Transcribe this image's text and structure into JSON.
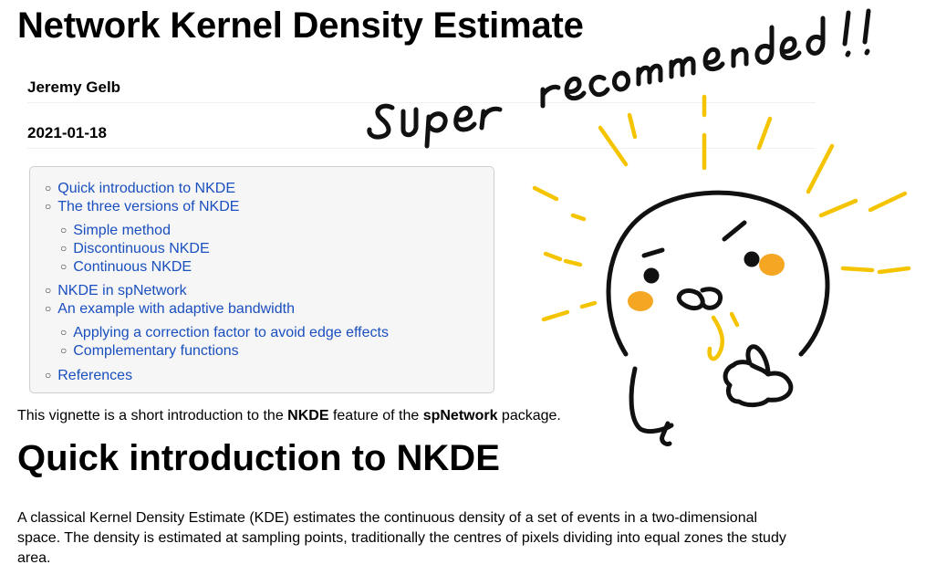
{
  "document": {
    "title": "Network Kernel Density Estimate",
    "author": "Jeremy Gelb",
    "date": "2021-01-18"
  },
  "toc": {
    "items": [
      {
        "label": "Quick introduction to NKDE",
        "level": 1
      },
      {
        "label": "The three versions of NKDE",
        "level": 1
      },
      {
        "label": "Simple method",
        "level": 2
      },
      {
        "label": "Discontinuous NKDE",
        "level": 2
      },
      {
        "label": "Continuous NKDE",
        "level": 2
      },
      {
        "label": "NKDE in spNetwork",
        "level": 1
      },
      {
        "label": "An example with adaptive bandwidth",
        "level": 1
      },
      {
        "label": "Applying a correction factor to avoid edge effects",
        "level": 2
      },
      {
        "label": "Complementary functions",
        "level": 2
      },
      {
        "label": "References",
        "level": 1
      }
    ]
  },
  "intro": {
    "part1": "This vignette is a short introduction to the ",
    "bold1": "NKDE",
    "part2": " feature of the ",
    "bold2": "spNetwork",
    "part3": " package."
  },
  "section": {
    "title": "Quick introduction to NKDE",
    "paragraph": "A classical Kernel Density Estimate (KDE) estimates the continuous density of a set of events in a two-dimensional space. The density is estimated at sampling points, traditionally the centres of pixels dividing into equal zones the study area."
  },
  "sticker": {
    "caption": "super recommended!!",
    "colors": {
      "rays": "#f5c400",
      "cheeks": "#f5a623",
      "ink": "#111111"
    }
  }
}
